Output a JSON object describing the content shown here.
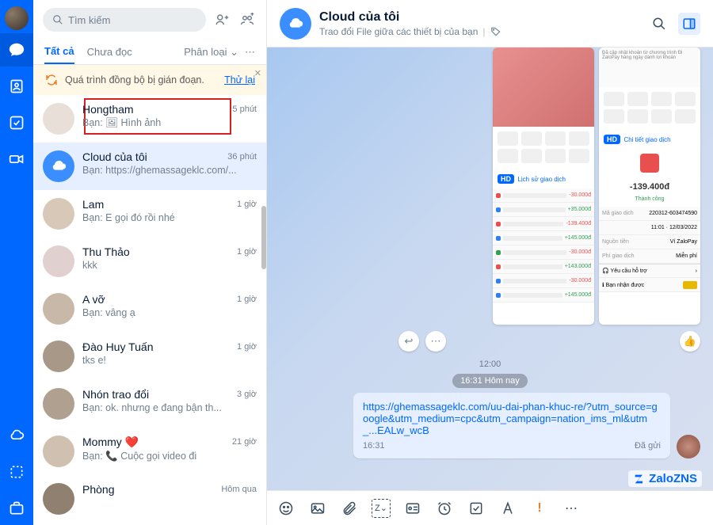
{
  "search": {
    "placeholder": "Tìm kiếm"
  },
  "tabs": {
    "all": "Tất cả",
    "unread": "Chưa đọc",
    "classify": "Phân loại"
  },
  "sync": {
    "text": "Quá trình đồng bộ bị gián đoạn.",
    "retry": "Thử lại"
  },
  "chats": [
    {
      "name": "Hongtham",
      "preview": "Bạn: 🖼 Hình ảnh",
      "time": "5 phút"
    },
    {
      "name": "Cloud của tôi",
      "preview": "Bạn: https://ghemassageklc.com/...",
      "time": "36 phút"
    },
    {
      "name": "Lam",
      "preview": "Bạn: E gọi đó rồi nhé",
      "time": "1 giờ"
    },
    {
      "name": "Thu Thảo",
      "preview": "kkk",
      "time": "1 giờ"
    },
    {
      "name": "A vỡ",
      "preview": "Bạn: vâng ạ",
      "time": "1 giờ"
    },
    {
      "name": "Đào Huy Tuấn",
      "preview": "tks e!",
      "time": "1 giờ"
    },
    {
      "name": "Nhón       trao đổi",
      "preview": "Bạn: ok.       nhưng e đang bận th...",
      "time": "3 giờ"
    },
    {
      "name": "Mommy ❤️",
      "preview": "Bạn: 📞 Cuộc gọi video đi",
      "time": "21 giờ"
    },
    {
      "name": "Phòng",
      "preview": "",
      "time": "Hôm qua"
    }
  ],
  "header": {
    "title": "Cloud của tôi",
    "subtitle": "Trao đổi File giữa các thiết bị của bạn"
  },
  "times": {
    "t1": "12:00",
    "divider": "16:31 Hôm nay",
    "sent": "16:31",
    "status": "Đã gửi"
  },
  "link_msg": "https://ghemassageklc.com/uu-dai-phan-khuc-re/?utm_source=google&utm_medium=cpc&utm_campaign=nation_ims_ml&utm_...EALw_wcB",
  "img_previews": {
    "amount": "-139.400đ",
    "hd": "HD",
    "left_caption": "Lịch sử giao dịch",
    "right_caption": "Chi tiết giao dịch",
    "status_ok": "Thành công"
  },
  "brand": "ZaloZNS"
}
